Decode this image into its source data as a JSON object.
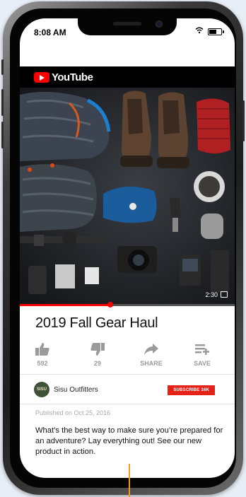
{
  "status_bar": {
    "time": "8:08 AM"
  },
  "header": {
    "brand": "YouTube"
  },
  "video": {
    "duration": "2:30",
    "progress_fraction": 0.42
  },
  "title": "2019 Fall Gear Haul",
  "actions": [
    {
      "name": "like-button",
      "icon": "thumbs-up-icon",
      "label": "592"
    },
    {
      "name": "dislike-button",
      "icon": "thumbs-down-icon",
      "label": "29"
    },
    {
      "name": "share-button",
      "icon": "share-arrow-icon",
      "label": "SHARE"
    },
    {
      "name": "save-button",
      "icon": "playlist-add-icon",
      "label": "SAVE"
    }
  ],
  "channel": {
    "avatar_text": "SISU",
    "name": "Sisu Outfitters",
    "subscribe_label": "SUBSCRIBE 16K"
  },
  "published": "Published on Oct 25, 2016",
  "description": "What’s the best way to make sure you’re prepared for an adventure? Lay everything out! See our new product in action.",
  "colors": {
    "youtube_red": "#ff0000",
    "subscribe_red": "#e62117",
    "annotation_line": "#f39c12"
  }
}
